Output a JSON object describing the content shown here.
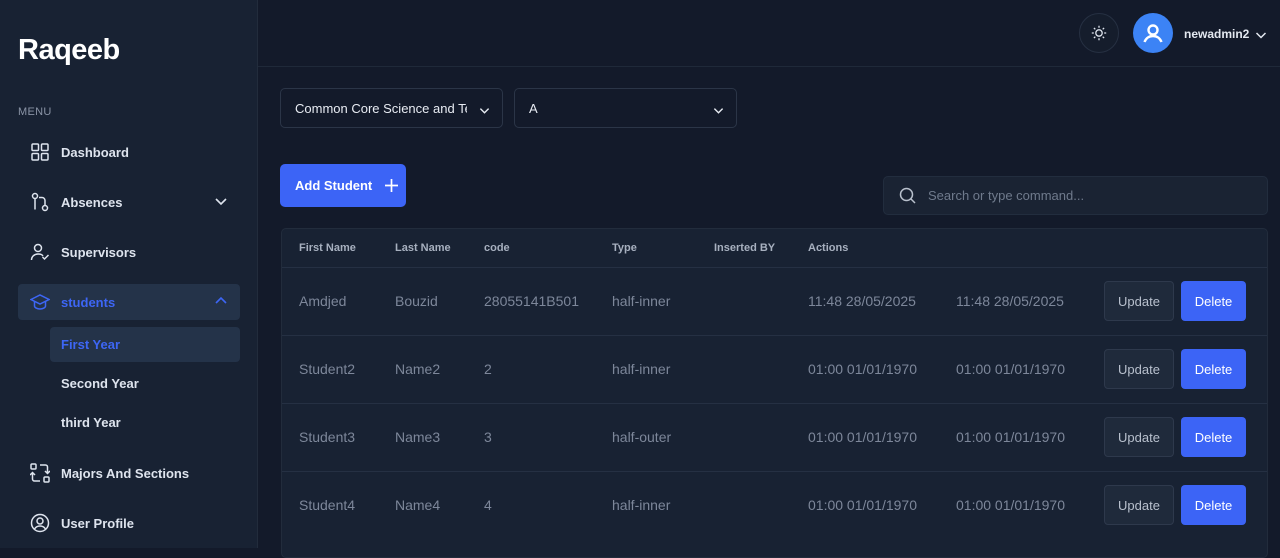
{
  "app": {
    "title": "Raqeeb"
  },
  "sidebar": {
    "menu_label": "MENU",
    "items": [
      {
        "label": "Dashboard",
        "icon": "grid-icon"
      },
      {
        "label": "Absences",
        "icon": "route-icon"
      },
      {
        "label": "Supervisors",
        "icon": "user-check-icon"
      },
      {
        "label": "students",
        "icon": "graduation-cap-icon"
      },
      {
        "label": "Majors And Sections",
        "icon": "swap-icon"
      },
      {
        "label": "User Profile",
        "icon": "user-circle-icon"
      }
    ],
    "sub_items": [
      {
        "label": "First Year"
      },
      {
        "label": "Second Year"
      },
      {
        "label": "third Year"
      }
    ]
  },
  "header": {
    "username": "newadmin2"
  },
  "filters": {
    "major": "Common Core Science and Technology",
    "section": "A"
  },
  "toolbar": {
    "add_label": "Add Student",
    "search_placeholder": "Search or type command..."
  },
  "table": {
    "headers": [
      "First Name",
      "Last Name",
      "code",
      "Type",
      "Inserted BY",
      "Actions"
    ],
    "rows": [
      {
        "first": "Amdjed",
        "last": "Bouzid",
        "code": "28055141B501",
        "type": "half-inner",
        "d1": "11:48 28/05/2025",
        "d2": "11:48 28/05/2025"
      },
      {
        "first": "Student2",
        "last": "Name2",
        "code": "2",
        "type": "half-inner",
        "d1": "01:00 01/01/1970",
        "d2": "01:00 01/01/1970"
      },
      {
        "first": "Student3",
        "last": "Name3",
        "code": "3",
        "type": "half-outer",
        "d1": "01:00 01/01/1970",
        "d2": "01:00 01/01/1970"
      },
      {
        "first": "Student4",
        "last": "Name4",
        "code": "4",
        "type": "half-inner",
        "d1": "01:00 01/01/1970",
        "d2": "01:00 01/01/1970"
      }
    ],
    "update_label": "Update",
    "delete_label": "Delete"
  },
  "colors": {
    "accent": "#3c64f6",
    "sidebar_bg": "#182233",
    "page_bg": "#131a2a"
  }
}
